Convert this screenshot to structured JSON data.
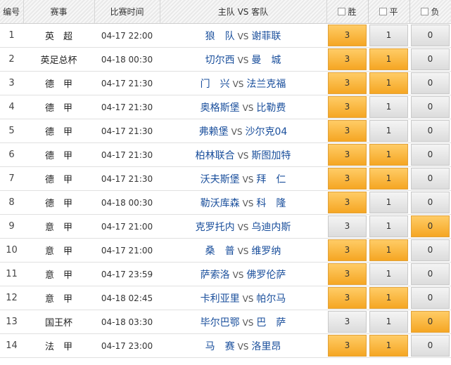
{
  "header": {
    "num": "编号",
    "league": "赛事",
    "time": "比赛时间",
    "match": "主队 VS 客队",
    "win": "胜",
    "draw": "平",
    "lose": "负"
  },
  "vs_label": "VS",
  "rows": [
    {
      "num": "1",
      "league": "英　超",
      "time": "04-17 22:00",
      "home": "狼　队",
      "away": "谢菲联",
      "win": "3",
      "draw": "1",
      "lose": "0",
      "win_sel": true,
      "draw_sel": false,
      "lose_sel": false
    },
    {
      "num": "2",
      "league": "英足总杯",
      "time": "04-18 00:30",
      "home": "切尔西",
      "away": "曼　城",
      "win": "3",
      "draw": "1",
      "lose": "0",
      "win_sel": true,
      "draw_sel": true,
      "lose_sel": false
    },
    {
      "num": "3",
      "league": "德　甲",
      "time": "04-17 21:30",
      "home": "门　兴",
      "away": "法兰克福",
      "win": "3",
      "draw": "1",
      "lose": "0",
      "win_sel": true,
      "draw_sel": true,
      "lose_sel": false
    },
    {
      "num": "4",
      "league": "德　甲",
      "time": "04-17 21:30",
      "home": "奥格斯堡",
      "away": "比勒费",
      "win": "3",
      "draw": "1",
      "lose": "0",
      "win_sel": true,
      "draw_sel": false,
      "lose_sel": false
    },
    {
      "num": "5",
      "league": "德　甲",
      "time": "04-17 21:30",
      "home": "弗赖堡",
      "away": "沙尔克04",
      "win": "3",
      "draw": "1",
      "lose": "0",
      "win_sel": true,
      "draw_sel": false,
      "lose_sel": false
    },
    {
      "num": "6",
      "league": "德　甲",
      "time": "04-17 21:30",
      "home": "柏林联合",
      "away": "斯图加特",
      "win": "3",
      "draw": "1",
      "lose": "0",
      "win_sel": true,
      "draw_sel": true,
      "lose_sel": false
    },
    {
      "num": "7",
      "league": "德　甲",
      "time": "04-17 21:30",
      "home": "沃夫斯堡",
      "away": "拜　仁",
      "win": "3",
      "draw": "1",
      "lose": "0",
      "win_sel": true,
      "draw_sel": true,
      "lose_sel": false
    },
    {
      "num": "8",
      "league": "德　甲",
      "time": "04-18 00:30",
      "home": "勒沃库森",
      "away": "科　隆",
      "win": "3",
      "draw": "1",
      "lose": "0",
      "win_sel": true,
      "draw_sel": false,
      "lose_sel": false
    },
    {
      "num": "9",
      "league": "意　甲",
      "time": "04-17 21:00",
      "home": "克罗托内",
      "away": "乌迪内斯",
      "win": "3",
      "draw": "1",
      "lose": "0",
      "win_sel": false,
      "draw_sel": false,
      "lose_sel": true
    },
    {
      "num": "10",
      "league": "意　甲",
      "time": "04-17 21:00",
      "home": "桑　普",
      "away": "维罗纳",
      "win": "3",
      "draw": "1",
      "lose": "0",
      "win_sel": true,
      "draw_sel": true,
      "lose_sel": false
    },
    {
      "num": "11",
      "league": "意　甲",
      "time": "04-17 23:59",
      "home": "萨索洛",
      "away": "佛罗伦萨",
      "win": "3",
      "draw": "1",
      "lose": "0",
      "win_sel": true,
      "draw_sel": false,
      "lose_sel": false
    },
    {
      "num": "12",
      "league": "意　甲",
      "time": "04-18 02:45",
      "home": "卡利亚里",
      "away": "帕尔马",
      "win": "3",
      "draw": "1",
      "lose": "0",
      "win_sel": true,
      "draw_sel": true,
      "lose_sel": false
    },
    {
      "num": "13",
      "league": "国王杯",
      "time": "04-18 03:30",
      "home": "毕尔巴鄂",
      "away": "巴　萨",
      "win": "3",
      "draw": "1",
      "lose": "0",
      "win_sel": false,
      "draw_sel": false,
      "lose_sel": true
    },
    {
      "num": "14",
      "league": "法　甲",
      "time": "04-17 23:00",
      "home": "马　赛",
      "away": "洛里昂",
      "win": "3",
      "draw": "1",
      "lose": "0",
      "win_sel": true,
      "draw_sel": true,
      "lose_sel": false
    }
  ],
  "colors": {
    "selected": "#f5a623",
    "unselected": "#e3e3e3",
    "team_link": "#1a4f9c"
  }
}
